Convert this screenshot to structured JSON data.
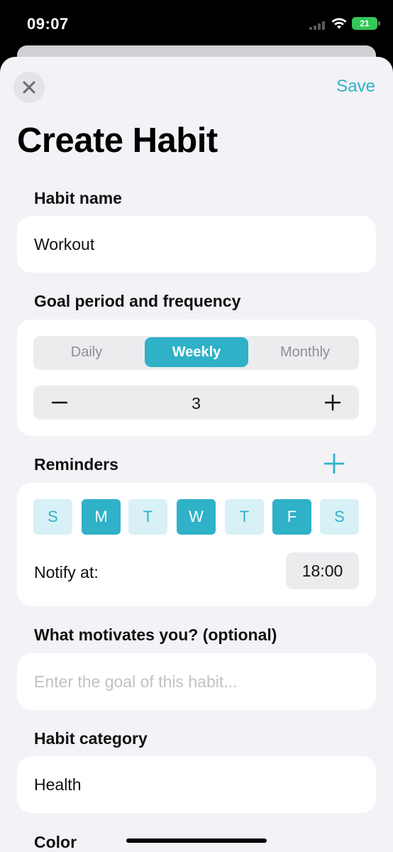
{
  "status": {
    "time": "09:07",
    "battery": "21"
  },
  "header": {
    "save_label": "Save",
    "title": "Create Habit"
  },
  "habit_name": {
    "label": "Habit name",
    "value": "Workout"
  },
  "goal": {
    "label": "Goal period and frequency",
    "periods": [
      "Daily",
      "Weekly",
      "Monthly"
    ],
    "selected_period": "Weekly",
    "frequency": "3"
  },
  "reminders": {
    "label": "Reminders",
    "days": [
      {
        "label": "S",
        "selected": false
      },
      {
        "label": "M",
        "selected": true
      },
      {
        "label": "T",
        "selected": false
      },
      {
        "label": "W",
        "selected": true
      },
      {
        "label": "T",
        "selected": false
      },
      {
        "label": "F",
        "selected": true
      },
      {
        "label": "S",
        "selected": false
      }
    ],
    "notify_label": "Notify at:",
    "notify_time": "18:00"
  },
  "motivation": {
    "label": "What motivates you? (optional)",
    "placeholder": "Enter the goal of this habit..."
  },
  "category": {
    "label": "Habit category",
    "value": "Health"
  },
  "color": {
    "label": "Color"
  },
  "colors": {
    "accent": "#2fb1c8",
    "accent_light": "#d8f1f6",
    "background": "#f2f2f7",
    "card": "#ffffff"
  },
  "icons": {
    "close": "close-icon",
    "add": "plus-icon",
    "decrement": "minus-icon",
    "increment": "plus-icon"
  }
}
